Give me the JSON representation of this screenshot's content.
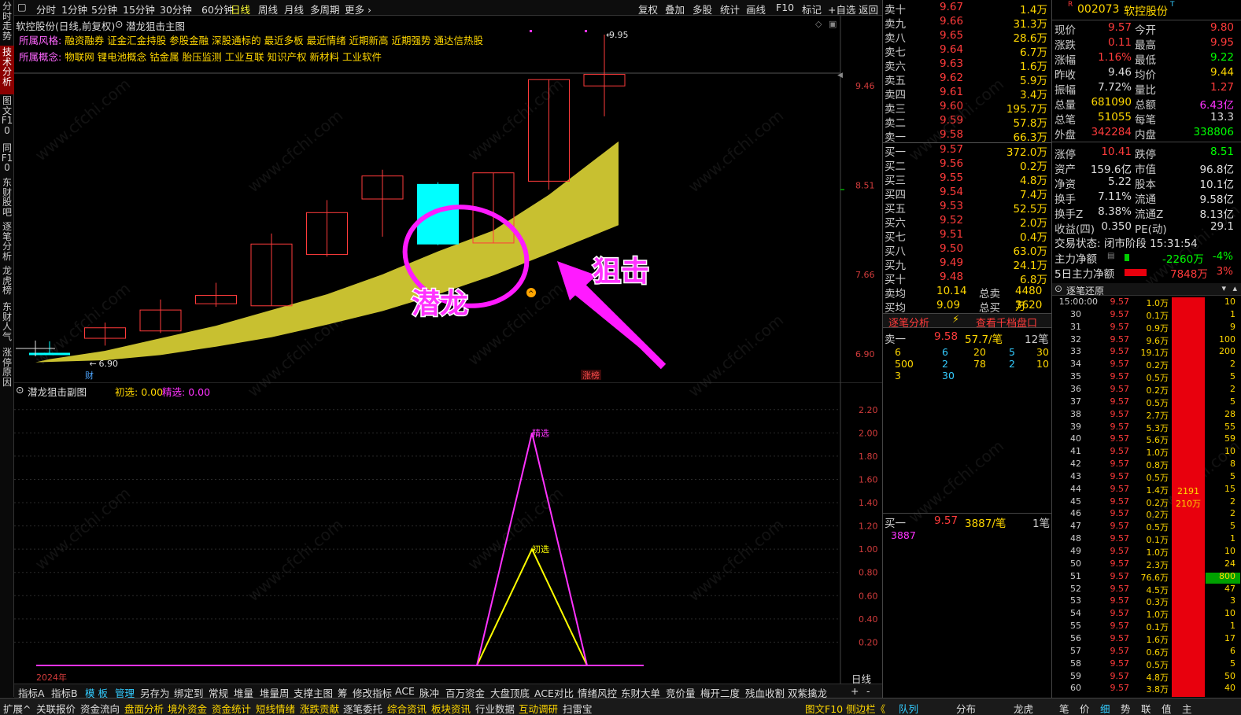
{
  "left_tabs": [
    {
      "label": "分时走势",
      "active": false
    },
    {
      "label": "技术分析",
      "active": true
    },
    {
      "label": "图文F10",
      "active": false
    },
    {
      "label": "同F10",
      "active": false
    },
    {
      "label": "东财股吧",
      "active": false
    },
    {
      "label": "逐笔分析",
      "active": false
    },
    {
      "label": "龙虎榜",
      "active": false
    },
    {
      "label": "东财人气",
      "active": false
    },
    {
      "label": "涨停原因",
      "active": false
    }
  ],
  "topbar": {
    "periods": [
      "分时",
      "1分钟",
      "5分钟",
      "15分钟",
      "30分钟",
      "60分钟",
      "日线",
      "周线",
      "月线",
      "多周期",
      "更多 ›"
    ],
    "selected": "日线",
    "actions": [
      "复权",
      "叠加",
      "多股",
      "统计",
      "画线",
      "F10",
      "标记",
      "+自选",
      "返回"
    ]
  },
  "main_chart": {
    "title": "软控股份(日线,前复权)",
    "indicator": "潜龙狙击主图",
    "style_label": "所属风格:",
    "style_tags": "融资融券 证金汇金持股 参股金融 深股通标的 最近多板 最近情绪 近期新高 近期强势 通达信热股",
    "concept_label": "所属概念:",
    "concept_tags": "物联网 锂电池概念 钴金属 胎压监测 工业互联 知识产权 新材料 工业软件",
    "y_axis": [
      "9.46",
      "8.51",
      "7.66",
      "6.90"
    ],
    "high_label": "9.95",
    "low_label": "6.90",
    "annot_left": "潜龙",
    "annot_right": "狙击",
    "small_tag": "涨榜",
    "cai_tag": "财"
  },
  "chart_data": {
    "type": "candlestick",
    "candles": [
      {
        "o": 6.9,
        "c": 6.9,
        "h": 7.02,
        "l": 6.9
      },
      {
        "o": 7.05,
        "c": 7.15,
        "h": 7.2,
        "l": 6.98
      },
      {
        "o": 7.12,
        "c": 7.32,
        "h": 7.42,
        "l": 7.1
      },
      {
        "o": 7.38,
        "c": 7.46,
        "h": 7.58,
        "l": 7.35
      },
      {
        "o": 7.36,
        "c": 7.95,
        "h": 8.05,
        "l": 7.36
      },
      {
        "o": 7.85,
        "c": 8.25,
        "h": 8.37,
        "l": 7.83
      },
      {
        "o": 8.38,
        "c": 8.6,
        "h": 8.66,
        "l": 8.02
      },
      {
        "o": 8.52,
        "c": 7.95,
        "h": 8.54,
        "l": 7.94
      },
      {
        "o": 7.96,
        "c": 8.63,
        "h": 8.63,
        "l": 7.96
      },
      {
        "o": 8.55,
        "c": 9.52,
        "h": 9.52,
        "l": 8.47
      },
      {
        "o": 9.46,
        "c": 9.57,
        "h": 9.95,
        "l": 9.17
      }
    ],
    "ylim": [
      6.78,
      9.98
    ],
    "band_upper": [
      6.85,
      6.93,
      7.05,
      7.17,
      7.32,
      7.47,
      7.66,
      7.88,
      8.08,
      8.42,
      8.93
    ],
    "band_lower": [
      6.82,
      6.84,
      6.89,
      6.97,
      7.06,
      7.18,
      7.31,
      7.47,
      7.65,
      7.86,
      8.13
    ],
    "sub": {
      "title": "潜龙狙击副图",
      "chuxuan_label": "初选:",
      "chuxuan_value": "0.00",
      "jingxuan_label": "精选:",
      "jingxuan_value": "0.00",
      "y_axis": [
        "2.20",
        "2.00",
        "1.80",
        "1.60",
        "1.40",
        "1.20",
        "1.00",
        "0.80",
        "0.60",
        "0.40",
        "0.20"
      ],
      "ylim": [
        0,
        2.3
      ],
      "chuxuan": [
        0,
        0,
        0,
        0,
        0,
        0,
        0,
        0,
        1,
        0,
        0
      ],
      "jingxuan": [
        0,
        0,
        0,
        0,
        0,
        0,
        0,
        0,
        2,
        0,
        0
      ],
      "peak_label_j": "精选",
      "peak_label_c": "初选",
      "year_label": "2024年",
      "period_label": "日线"
    }
  },
  "indicator_bar": [
    "指标A",
    "指标B",
    "模 板",
    "管理",
    "另存为",
    "绑定到",
    "常规",
    "堆量",
    "堆量周",
    "支撑主图",
    "筹",
    "修改指标",
    "ACE",
    "脉冲",
    "百万资金",
    "大盘顶底",
    "ACE对比",
    "情绪风控",
    "东财大单",
    "竞价量",
    "梅开二度",
    "残血收割",
    "双紫擒龙",
    "+",
    "-"
  ],
  "status_bar": [
    "扩展^",
    "关联报价",
    "资金流向",
    "盘面分析",
    "境外资金",
    "资金统计",
    "短线情绪",
    "涨跌贡献",
    "逐笔委托",
    "综合资讯",
    "板块资讯",
    "行业数据",
    "互动调研",
    "扫雷宝",
    "图文F10 侧边栏《",
    "队列",
    "分布",
    "龙虎",
    "笔",
    "价",
    "细",
    "势",
    "联",
    "值",
    "主"
  ],
  "orderbook": {
    "asks": [
      {
        "name": "卖十",
        "price": "9.67",
        "vol": "1.4万"
      },
      {
        "name": "卖九",
        "price": "9.66",
        "vol": "31.3万"
      },
      {
        "name": "卖八",
        "price": "9.65",
        "vol": "28.6万"
      },
      {
        "name": "卖七",
        "price": "9.64",
        "vol": "6.7万"
      },
      {
        "name": "卖六",
        "price": "9.63",
        "vol": "1.6万"
      },
      {
        "name": "卖五",
        "price": "9.62",
        "vol": "5.9万"
      },
      {
        "name": "卖四",
        "price": "9.61",
        "vol": "3.4万"
      },
      {
        "name": "卖三",
        "price": "9.60",
        "vol": "195.7万"
      },
      {
        "name": "卖二",
        "price": "9.59",
        "vol": "57.8万"
      },
      {
        "name": "卖一",
        "price": "9.58",
        "vol": "66.3万"
      }
    ],
    "bids": [
      {
        "name": "买一",
        "price": "9.57",
        "vol": "372.0万"
      },
      {
        "name": "买二",
        "price": "9.56",
        "vol": "0.2万"
      },
      {
        "name": "买三",
        "price": "9.55",
        "vol": "4.8万"
      },
      {
        "name": "买四",
        "price": "9.54",
        "vol": "7.4万"
      },
      {
        "name": "买五",
        "price": "9.53",
        "vol": "52.5万"
      },
      {
        "name": "买六",
        "price": "9.52",
        "vol": "2.0万"
      },
      {
        "name": "买七",
        "price": "9.51",
        "vol": "0.4万"
      },
      {
        "name": "买八",
        "price": "9.50",
        "vol": "63.0万"
      },
      {
        "name": "买九",
        "price": "9.49",
        "vol": "24.1万"
      },
      {
        "name": "买十",
        "price": "9.48",
        "vol": "6.8万"
      }
    ],
    "sell_avg_label": "卖均",
    "sell_avg": "10.14",
    "total_sell_label": "总卖",
    "total_sell": "4480万",
    "buy_avg_label": "买均",
    "buy_avg": "9.09",
    "total_buy_label": "总买",
    "total_buy": "3620万",
    "tab1": "逐笔分析",
    "tab2": "查看千档盘口",
    "s1_name": "卖一",
    "s1_price": "9.58",
    "s1_vol": "57.7/笔",
    "s1_count": "12笔",
    "queue_rows": [
      [
        "6",
        "6",
        "20",
        "5",
        "30"
      ],
      [
        "500",
        "2",
        "78",
        "2",
        "10"
      ],
      [
        "3",
        "30",
        "",
        "",
        ""
      ]
    ],
    "b1_name": "买一",
    "b1_price": "9.57",
    "b1_vol": "3887/笔",
    "b1_count": "1笔",
    "b1_queue": "3887"
  },
  "quote": {
    "code": "002073",
    "name": "软控股份",
    "rows": [
      [
        "现价",
        "9.57",
        "今开",
        "9.80"
      ],
      [
        "涨跌",
        "0.11",
        "最高",
        "9.95"
      ],
      [
        "涨幅",
        "1.16%",
        "最低",
        "9.22"
      ],
      [
        "昨收",
        "9.46",
        "均价",
        "9.44"
      ],
      [
        "振幅",
        "7.72%",
        "量比",
        "1.27"
      ],
      [
        "总量",
        "681090",
        "总额",
        "6.43亿"
      ],
      [
        "总笔",
        "51055",
        "每笔",
        "13.3"
      ],
      [
        "外盘",
        "342284",
        "内盘",
        "338806"
      ],
      [
        "涨停",
        "10.41",
        "跌停",
        "8.51"
      ],
      [
        "资产",
        "159.6亿",
        "市值",
        "96.8亿"
      ],
      [
        "净资",
        "5.22",
        "股本",
        "10.1亿"
      ],
      [
        "换手",
        "7.11%",
        "流通",
        "9.58亿"
      ],
      [
        "换手Z",
        "8.38%",
        "流通Z",
        "8.13亿"
      ],
      [
        "收益(四)",
        "0.350",
        "PE(动)",
        "29.1"
      ]
    ],
    "trade_status": "交易状态: 闭市阶段 15:31:54",
    "main_net_label": "主力净额",
    "main_net": "-2260万",
    "main_net_pct": "-4%",
    "main5_label": "5日主力净额",
    "main5": "7848万",
    "main5_pct": "3%",
    "ticks_title": "逐笔还原"
  },
  "ticks": [
    [
      "15:00:00",
      "9.57",
      "1.0万",
      "10"
    ],
    [
      "30",
      "9.57",
      "0.1万",
      "1"
    ],
    [
      "31",
      "9.57",
      "0.9万",
      "9"
    ],
    [
      "32",
      "9.57",
      "9.6万",
      "100"
    ],
    [
      "33",
      "9.57",
      "19.1万",
      "200"
    ],
    [
      "34",
      "9.57",
      "0.2万",
      "2"
    ],
    [
      "35",
      "9.57",
      "0.5万",
      "5"
    ],
    [
      "36",
      "9.57",
      "0.2万",
      "2"
    ],
    [
      "37",
      "9.57",
      "0.5万",
      "5"
    ],
    [
      "38",
      "9.57",
      "2.7万",
      "28"
    ],
    [
      "39",
      "9.57",
      "5.3万",
      "55"
    ],
    [
      "40",
      "9.57",
      "5.6万",
      "59"
    ],
    [
      "41",
      "9.57",
      "1.0万",
      "10"
    ],
    [
      "42",
      "9.57",
      "0.8万",
      "8"
    ],
    [
      "43",
      "9.57",
      "0.5万",
      "5"
    ],
    [
      "44",
      "9.57",
      "1.4万",
      "15"
    ],
    [
      "45",
      "9.57",
      "0.2万",
      "2"
    ],
    [
      "46",
      "9.57",
      "0.2万",
      "2"
    ],
    [
      "47",
      "9.57",
      "0.5万",
      "5"
    ],
    [
      "48",
      "9.57",
      "0.1万",
      "1"
    ],
    [
      "49",
      "9.57",
      "1.0万",
      "10"
    ],
    [
      "50",
      "9.57",
      "2.3万",
      "24"
    ],
    [
      "51",
      "9.57",
      "76.6万",
      "800"
    ],
    [
      "52",
      "9.57",
      "4.5万",
      "47"
    ],
    [
      "53",
      "9.57",
      "0.3万",
      "3"
    ],
    [
      "54",
      "9.57",
      "1.0万",
      "10"
    ],
    [
      "55",
      "9.57",
      "0.1万",
      "1"
    ],
    [
      "56",
      "9.57",
      "1.6万",
      "17"
    ],
    [
      "57",
      "9.57",
      "0.6万",
      "6"
    ],
    [
      "58",
      "9.57",
      "0.5万",
      "5"
    ],
    [
      "59",
      "9.57",
      "4.8万",
      "50"
    ],
    [
      "60",
      "9.57",
      "3.8万",
      "40"
    ]
  ],
  "tick_bar_labels": [
    "2191",
    "210万"
  ],
  "watermark": "www.cfchi.com"
}
